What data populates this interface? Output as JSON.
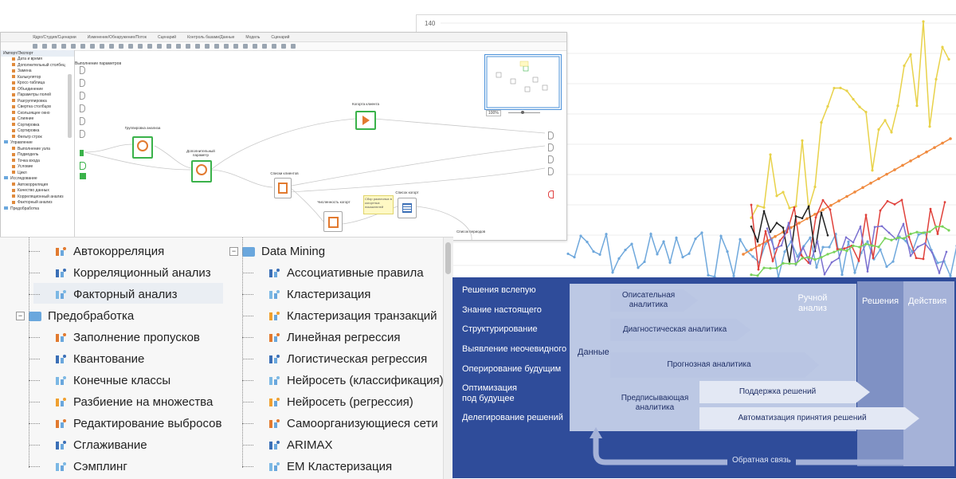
{
  "chart": {
    "y_tick_label": "140",
    "colors": {
      "blue": "#6fa8dc",
      "yellow": "#e8d24a",
      "orange": "#f08a3e",
      "red": "#e0413b",
      "black": "#222222",
      "purple": "#7a6fd0",
      "green": "#79d35a"
    }
  },
  "workflow": {
    "breadcrumbs": [
      "Ядро/Студия/Сценарии",
      "Изменение/Обнаружение/Поток",
      "Сценарий",
      "Контроль базами/Данные",
      "Модель",
      "Сценарий"
    ],
    "left_header": "Импорт/Экспорт",
    "left_items": [
      {
        "t": "Дата и время",
        "g": false
      },
      {
        "t": "Дополнительный столбец",
        "g": false
      },
      {
        "t": "Замена",
        "g": false
      },
      {
        "t": "Калькулятор",
        "g": false
      },
      {
        "t": "Кросс-таблица",
        "g": false
      },
      {
        "t": "Объединение",
        "g": false
      },
      {
        "t": "Параметры полей",
        "g": false
      },
      {
        "t": "Разгруппировка",
        "g": false
      },
      {
        "t": "Свертка столбцов",
        "g": false
      },
      {
        "t": "Скользящее окно",
        "g": false
      },
      {
        "t": "Слияние",
        "g": false
      },
      {
        "t": "Сортировка",
        "g": false
      },
      {
        "t": "Сортировка",
        "g": false
      },
      {
        "t": "Фильтр строк",
        "g": false
      },
      {
        "t": "Управление",
        "g": true
      },
      {
        "t": "Выполнение узла",
        "g": false
      },
      {
        "t": "Подмодель",
        "g": false
      },
      {
        "t": "Точка входа",
        "g": false
      },
      {
        "t": "Условие",
        "g": false
      },
      {
        "t": "Цикл",
        "g": false
      },
      {
        "t": "Исследование",
        "g": true
      },
      {
        "t": "Автокорреляция",
        "g": false
      },
      {
        "t": "Качество данных",
        "g": false
      },
      {
        "t": "Корреляционный анализ",
        "g": false
      },
      {
        "t": "Факторный анализ",
        "g": false
      },
      {
        "t": "Предобработка",
        "g": true
      }
    ],
    "canvas_title": "Выполнение параметров",
    "nodes": [
      {
        "label": "Группировка анализа",
        "sub": "Данные"
      },
      {
        "label": "Дополнительный параметр",
        "sub": "Данные"
      },
      {
        "label": "Списки клиентов",
        "sub": ""
      },
      {
        "label": "Когорта клиента",
        "sub": ""
      },
      {
        "label": "Численность когорт",
        "sub": ""
      },
      {
        "label": "Список когорт",
        "sub": ""
      },
      {
        "label": "Список периодов",
        "sub": ""
      }
    ],
    "note_text": "Сбор различных в когортных показателей",
    "zoom_label": "100%"
  },
  "tree": {
    "left": [
      {
        "label": "Автокорреляция",
        "icon": "autocorrelation-icon"
      },
      {
        "label": "Корреляционный анализ",
        "icon": "correlation-icon"
      },
      {
        "label": "Факторный анализ",
        "icon": "factor-analysis-icon"
      },
      {
        "label": "Предобработка",
        "icon": "folder-icon",
        "group": true
      },
      {
        "label": "Заполнение пропусков",
        "icon": "fill-gaps-icon"
      },
      {
        "label": "Квантование",
        "icon": "quantization-icon"
      },
      {
        "label": "Конечные классы",
        "icon": "final-classes-icon"
      },
      {
        "label": "Разбиение на множества",
        "icon": "partition-icon"
      },
      {
        "label": "Редактирование выбросов",
        "icon": "outliers-icon"
      },
      {
        "label": "Сглаживание",
        "icon": "smoothing-icon"
      },
      {
        "label": "Сэмплинг",
        "icon": "sampling-icon"
      }
    ],
    "right": [
      {
        "label": "Data Mining",
        "icon": "folder-icon",
        "group": true
      },
      {
        "label": "Ассоциативные правила",
        "icon": "cart-icon"
      },
      {
        "label": "Кластеризация",
        "icon": "cluster-icon"
      },
      {
        "label": "Кластеризация транзакций",
        "icon": "transaction-cluster-icon"
      },
      {
        "label": "Линейная регрессия",
        "icon": "linear-regression-icon"
      },
      {
        "label": "Логистическая регрессия",
        "icon": "logistic-regression-icon"
      },
      {
        "label": "Нейросеть (классификация)",
        "icon": "neural-classification-icon"
      },
      {
        "label": "Нейросеть (регрессия)",
        "icon": "neural-regression-icon"
      },
      {
        "label": "Самоорганизующиеся сети",
        "icon": "som-icon"
      },
      {
        "label": "ARIMAX",
        "icon": "arimax-icon"
      },
      {
        "label": "EM Кластеризация",
        "icon": "em-cluster-icon"
      }
    ]
  },
  "analytics": {
    "left_labels": [
      "Решения вслепую",
      "Знание настоящего",
      "Структурирование",
      "Выявление неочевидного",
      "Оперирование будущим",
      "Оптимизация\nпод будущее",
      "Делегирование решений"
    ],
    "data_label": "Данные",
    "manual_label": "Ручной\nанализ",
    "decisions_label": "Решения",
    "actions_label": "Действия",
    "arrows": [
      "Описательная\nаналитика",
      "Диагностическая аналитика",
      "Прогнозная аналитика",
      "Поддержка решений",
      "Автоматизация принятия решений"
    ],
    "prescriptive_label": "Предписывающая\nаналитика",
    "feedback_label": "Обратная связь"
  }
}
